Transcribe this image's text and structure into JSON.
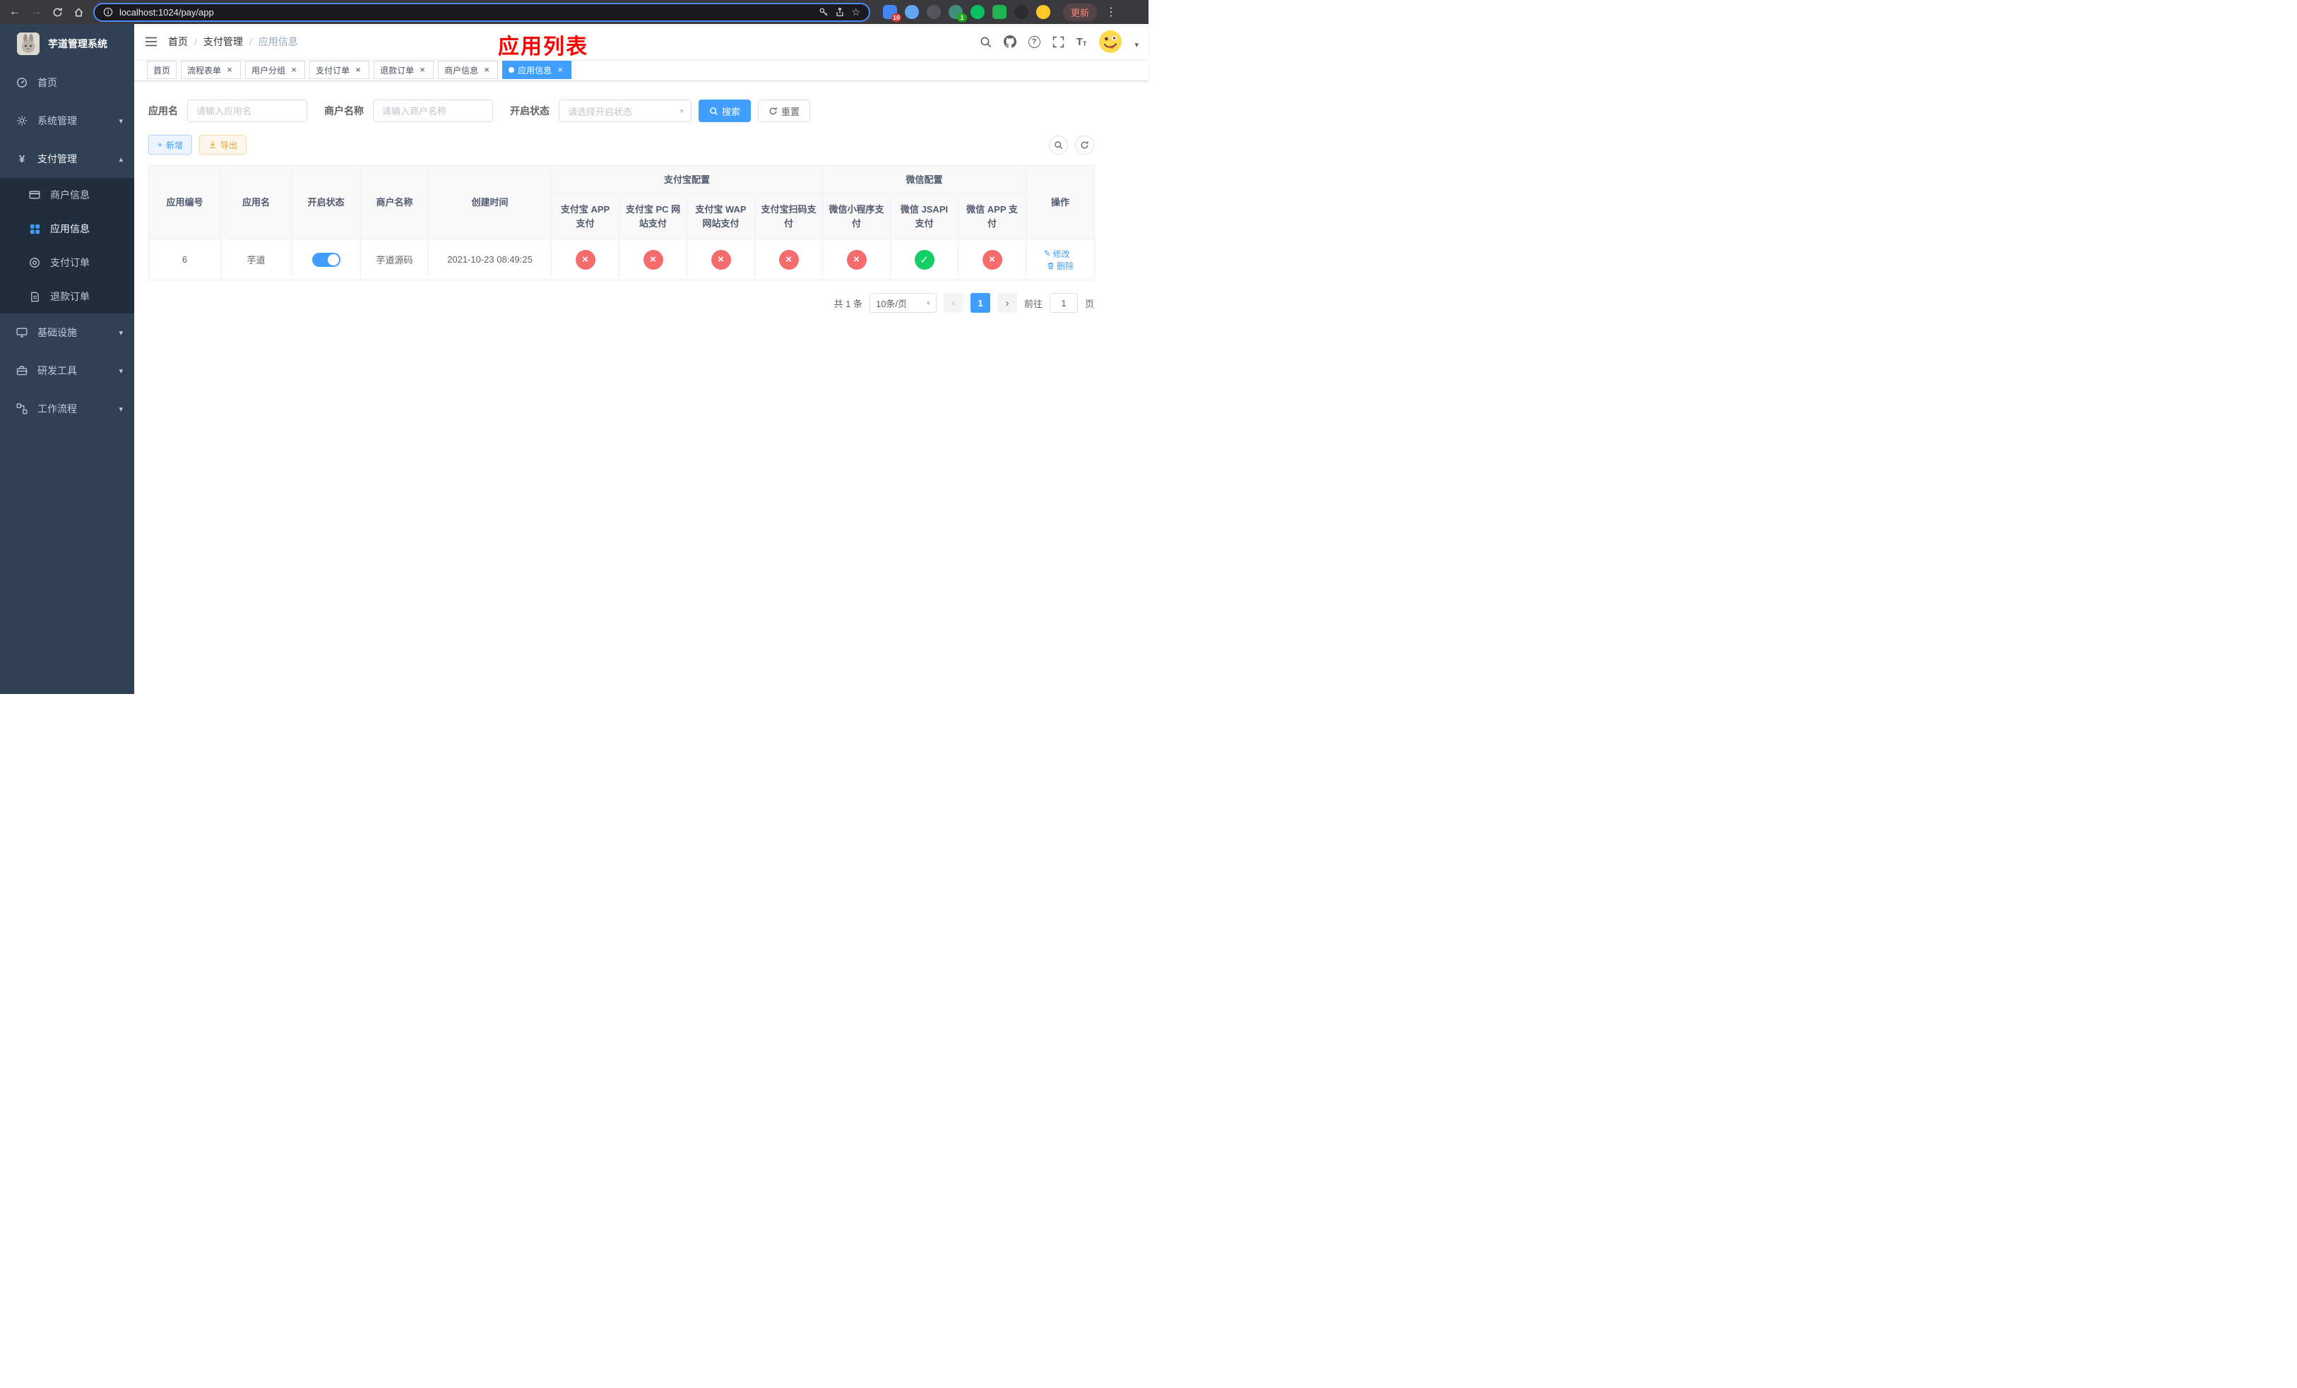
{
  "icons": {
    "back": "←",
    "forward": "→",
    "star": "☆",
    "menu_dots": "⋮",
    "yen": "¥",
    "chevron_down": "▾",
    "chevron_up": "▴",
    "caret_down": "▾",
    "page_prev": "‹",
    "page_next": "›",
    "close": "×",
    "plus": "+",
    "question": "?",
    "edit_glyph": "✎",
    "letter_T": "T"
  },
  "browser": {
    "url": "localhost:1024/pay/app",
    "update_label": "更新",
    "ext_badge_1": "10",
    "ext_badge_2": "1"
  },
  "sidebar": {
    "title": "芋道管理系统",
    "home": "首页",
    "system": "系统管理",
    "payment": "支付管理",
    "merchant_info": "商户信息",
    "app_info": "应用信息",
    "pay_order": "支付订单",
    "refund_order": "退款订单",
    "infra": "基础设施",
    "dev_tools": "研发工具",
    "workflow": "工作流程"
  },
  "header": {
    "crumb_home": "首页",
    "crumb_payment": "支付管理",
    "crumb_current": "应用信息",
    "separator": "/",
    "page_title": "应用列表"
  },
  "tabs": [
    {
      "label": "首页"
    },
    {
      "label": "流程表单"
    },
    {
      "label": "用户分组"
    },
    {
      "label": "支付订单"
    },
    {
      "label": "退款订单"
    },
    {
      "label": "商户信息"
    },
    {
      "label": "应用信息"
    }
  ],
  "filter": {
    "app_name_label": "应用名",
    "app_name_placeholder": "请输入应用名",
    "merchant_label": "商户名称",
    "merchant_placeholder": "请输入商户名称",
    "status_label": "开启状态",
    "status_placeholder": "请选择开启状态",
    "search_label": "搜索",
    "reset_label": "重置"
  },
  "toolbar": {
    "add_label": "新增",
    "export_label": "导出"
  },
  "table": {
    "col_app_id": "应用编号",
    "col_app_name": "应用名",
    "col_status": "开启状态",
    "col_merchant": "商户名称",
    "col_created": "创建时间",
    "group_alipay": "支付宝配置",
    "group_wechat": "微信配置",
    "col_actions": "操作",
    "sub_headers": [
      "支付宝 APP 支付",
      "支付宝 PC 网站支付",
      "支付宝 WAP 网站支付",
      "支付宝扫码支付",
      "微信小程序支付",
      "微信 JSAPI 支付",
      "微信 APP 支付"
    ],
    "row": {
      "app_id": "6",
      "app_name": "芋道",
      "merchant": "芋道源码",
      "created": "2021-10-23 08:49:25",
      "channels": [
        {
          "cls": "badge badge-off",
          "glyph": "×"
        },
        {
          "cls": "badge badge-off",
          "glyph": "×"
        },
        {
          "cls": "badge badge-off",
          "glyph": "×"
        },
        {
          "cls": "badge badge-off",
          "glyph": "×"
        },
        {
          "cls": "badge badge-off",
          "glyph": "×"
        },
        {
          "cls": "badge badge-on",
          "glyph": "✓"
        },
        {
          "cls": "badge badge-off",
          "glyph": "×"
        }
      ],
      "edit_label": "修改",
      "delete_label": "删除"
    }
  },
  "pagination": {
    "total": "共 1 条",
    "page_size": "10条/页",
    "current_page": "1",
    "goto_label": "前往",
    "goto_value": "1",
    "page_unit": "页"
  },
  "colors": {
    "primary": "#409eff",
    "danger": "#f56c6c",
    "success": "#13ce66",
    "warning": "#e6a23c",
    "title_red": "#ff0000",
    "sidebar_bg": "#304156",
    "submenu_bg": "#1f2d3d"
  }
}
